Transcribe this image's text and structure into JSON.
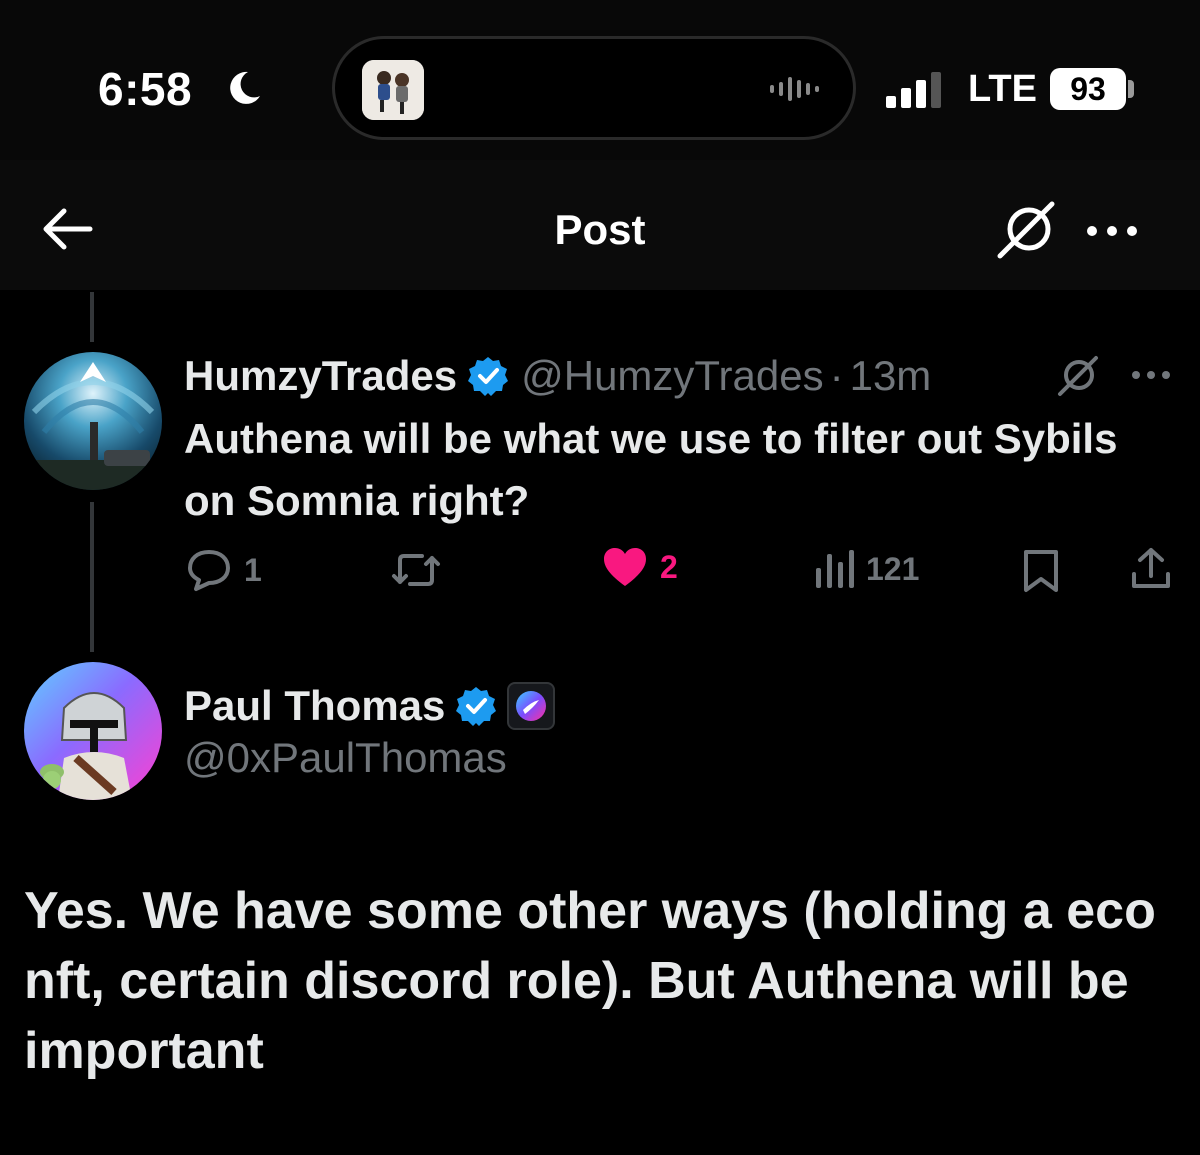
{
  "status_bar": {
    "time": "6:58",
    "network": "LTE",
    "battery": "93",
    "icons": [
      "moon-icon",
      "audio-wave-icon",
      "signal-icon"
    ]
  },
  "nav": {
    "title": "Post",
    "icons": [
      "back-arrow-icon",
      "grok-icon",
      "more-icon"
    ]
  },
  "tweet1": {
    "display_name": "HumzyTrades",
    "handle": "@HumzyTrades",
    "separator": "·",
    "time": "13m",
    "text": "Authena will be what we use to filter out Sybils on Somnia right?",
    "actions": {
      "replies": "1",
      "likes": "2",
      "views": "121"
    },
    "colors": {
      "like": "#f91880",
      "verified": "#1d9bf0"
    }
  },
  "tweet2": {
    "display_name": "Paul Thomas",
    "handle": "@0xPaulThomas",
    "text": "Yes. We have some other ways (holding a eco nft, certain discord role). But Authena will be important"
  }
}
